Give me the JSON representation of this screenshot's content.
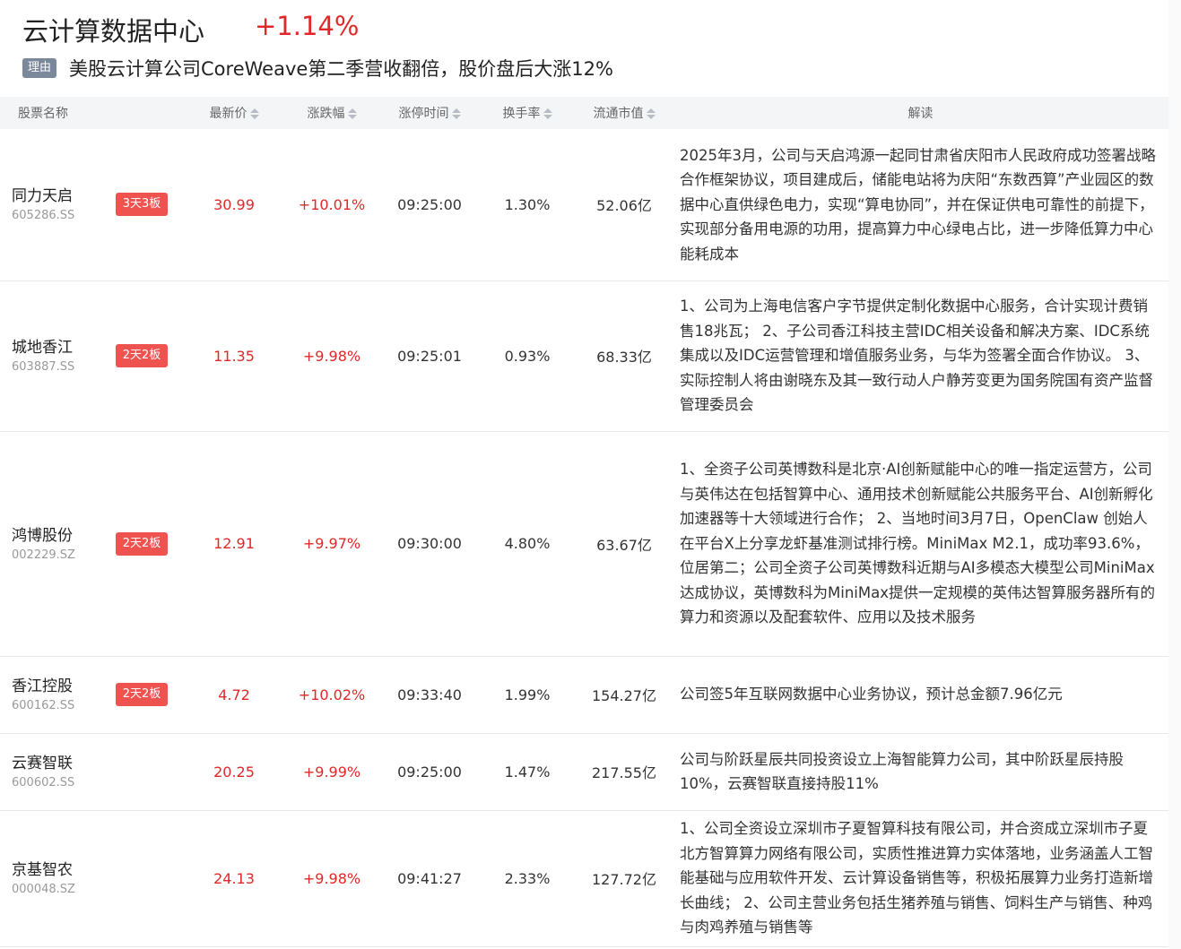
{
  "header": {
    "title": "云计算数据中心",
    "change": "+1.14%",
    "reason_tag": "理由",
    "reason_text": "美股云计算公司CoreWeave第二季营收翻倍，股价盘后大涨12%"
  },
  "columns": {
    "name": "股票名称",
    "price": "最新价",
    "change": "涨跌幅",
    "limit_time": "涨停时间",
    "turnover": "换手率",
    "market_cap": "流通市值",
    "desc": "解读"
  },
  "rows": [
    {
      "name": "同力天启",
      "code": "605286.SS",
      "badge": "3天3板",
      "price": "30.99",
      "change": "+10.01%",
      "time": "09:25:00",
      "turnover": "1.30%",
      "cap": "52.06亿",
      "desc": "2025年3月，公司与天启鸿源一起同甘肃省庆阳市人民政府成功签署战略合作框架协议，项目建成后，储能电站将为庆阳“东数西算”产业园区的数据中心直供绿色电力，实现“算电协同”，并在保证供电可靠性的前提下，实现部分备用电源的功用，提高算力中心绿电占比，进一步降低算力中心能耗成本"
    },
    {
      "name": "城地香江",
      "code": "603887.SS",
      "badge": "2天2板",
      "price": "11.35",
      "change": "+9.98%",
      "time": "09:25:01",
      "turnover": "0.93%",
      "cap": "68.33亿",
      "desc": "1、公司为上海电信客户字节提供定制化数据中心服务，合计实现计费销售18兆瓦； 2、子公司香江科技主营IDC相关设备和解决方案、IDC系统集成以及IDC运营管理和增值服务业务，与华为签署全面合作协议。 3、实际控制人将由谢晓东及其一致行动人户静芳变更为国务院国有资产监督管理委员会"
    },
    {
      "name": "鸿博股份",
      "code": "002229.SZ",
      "badge": "2天2板",
      "price": "12.91",
      "change": "+9.97%",
      "time": "09:30:00",
      "turnover": "4.80%",
      "cap": "63.67亿",
      "desc": "1、全资子公司英博数科是北京·AI创新赋能中心的唯一指定运营方，公司与英伟达在包括智算中心、通用技术创新赋能公共服务平台、AI创新孵化加速器等十大领域进行合作； 2、当地时间3月7日，OpenClaw 创始人在平台X上分享龙虾基准测试排行榜。MiniMax M2.1，成功率93.6%，位居第二；公司全资子公司英博数科近期与AI多模态大模型公司MiniMax达成协议，英博数科为MiniMax提供一定规模的英伟达智算服务器所有的算力和资源以及配套软件、应用以及技术服务"
    },
    {
      "name": "香江控股",
      "code": "600162.SS",
      "badge": "2天2板",
      "price": "4.72",
      "change": "+10.02%",
      "time": "09:33:40",
      "turnover": "1.99%",
      "cap": "154.27亿",
      "desc": "公司签5年互联网数据中心业务协议，预计总金额7.96亿元"
    },
    {
      "name": "云赛智联",
      "code": "600602.SS",
      "badge": "",
      "price": "20.25",
      "change": "+9.99%",
      "time": "09:25:00",
      "turnover": "1.47%",
      "cap": "217.55亿",
      "desc": "公司与阶跃星辰共同投资设立上海智能算力公司，其中阶跃星辰持股10%，云赛智联直接持股11%"
    },
    {
      "name": "京基智农",
      "code": "000048.SZ",
      "badge": "",
      "price": "24.13",
      "change": "+9.98%",
      "time": "09:41:27",
      "turnover": "2.33%",
      "cap": "127.72亿",
      "desc": "1、公司全资设立深圳市子夏智算科技有限公司，并合资成立深圳市子夏北方智算算力网络有限公司，实质性推进算力实体落地，业务涵盖人工智能基础与应用软件开发、云计算设备销售等，积极拓展算力业务打造新增长曲线； 2、公司主营业务包括生猪养殖与销售、饲料生产与销售、种鸡与肉鸡养殖与销售等"
    }
  ]
}
